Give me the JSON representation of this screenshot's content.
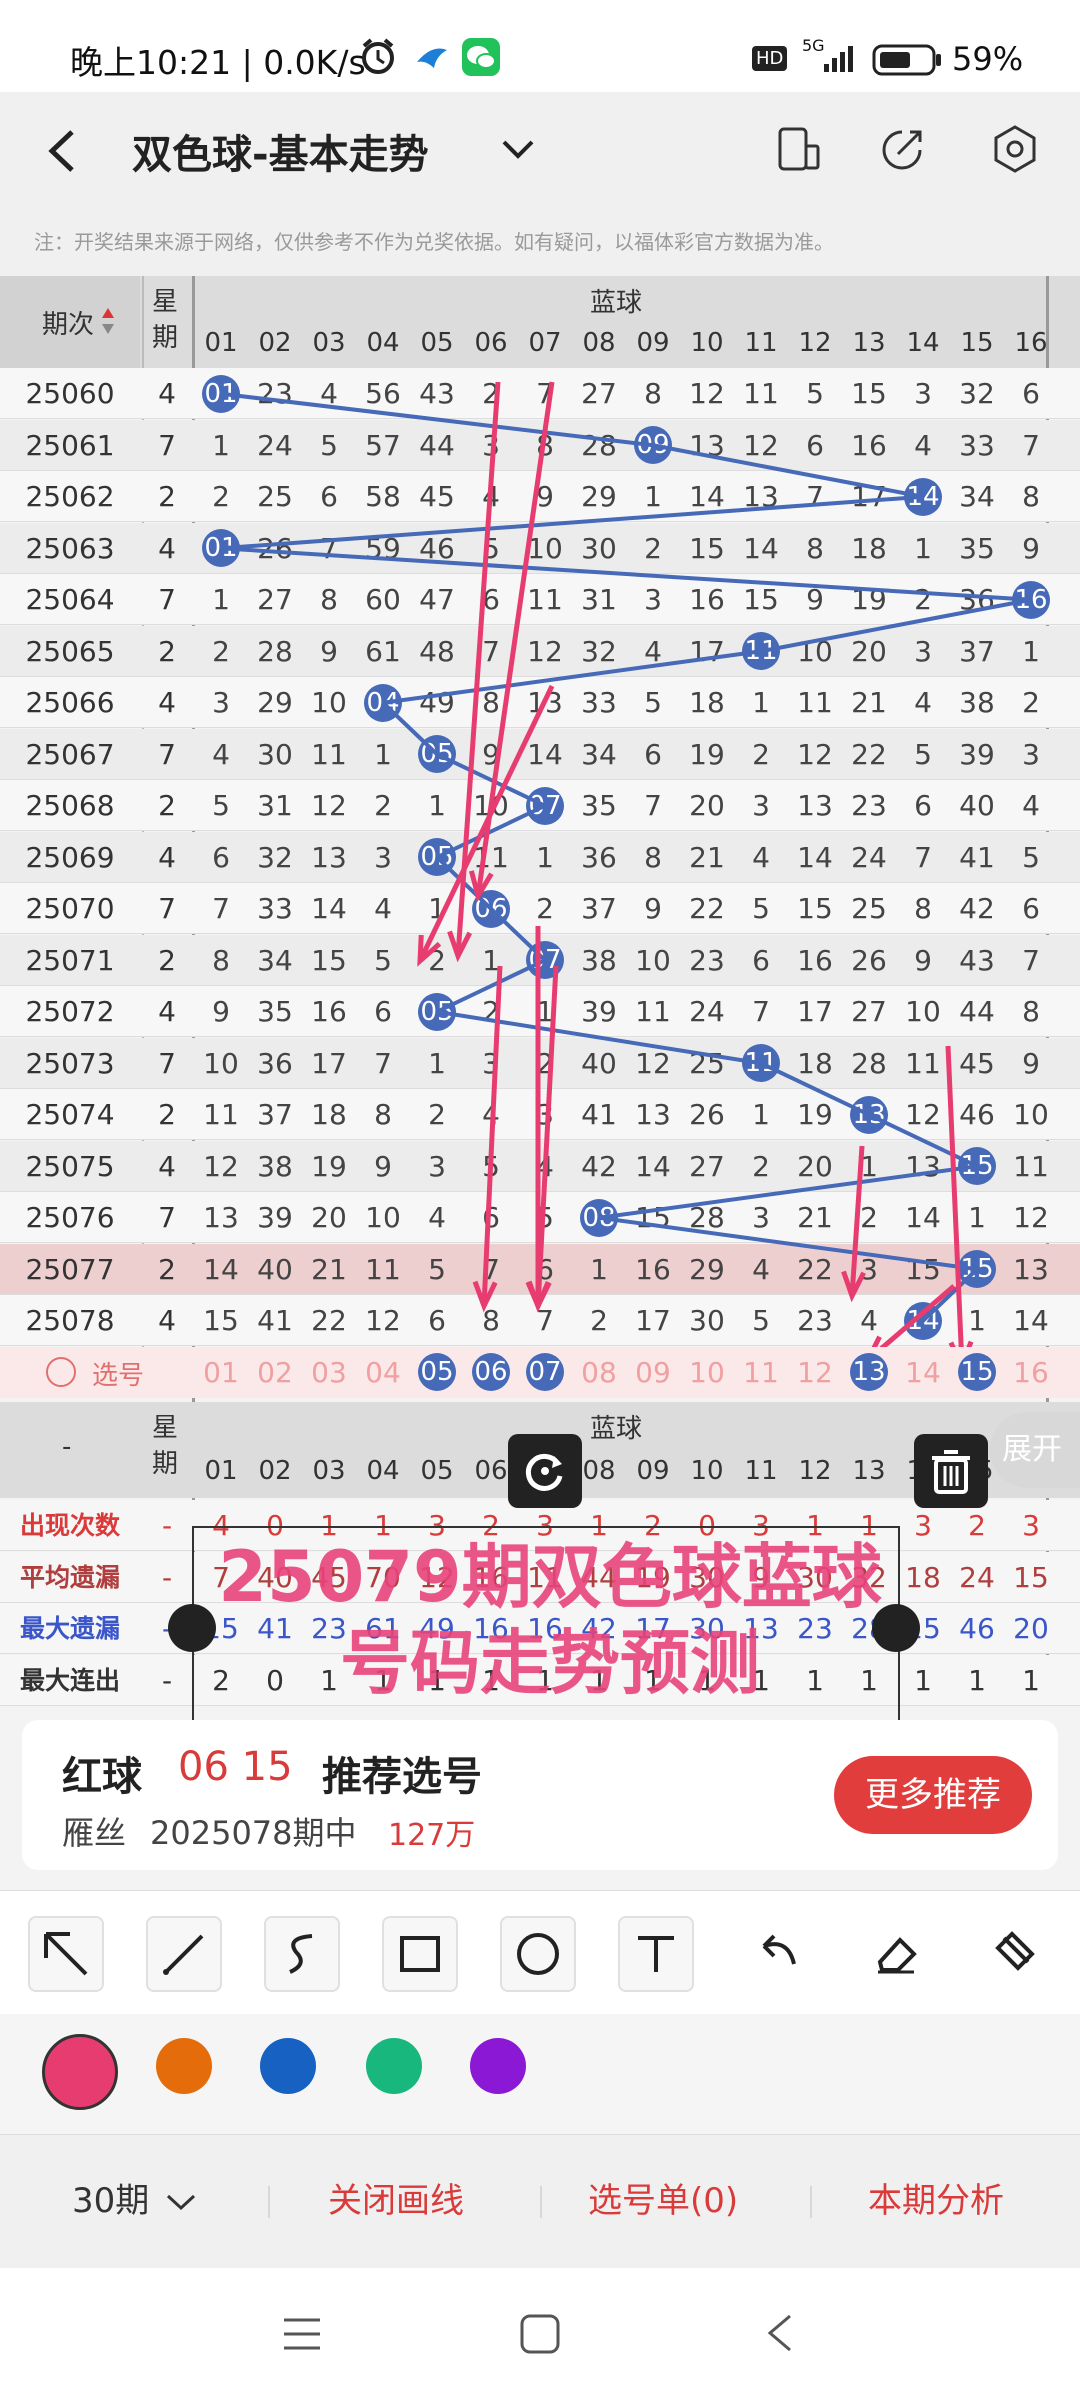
{
  "status": {
    "time": "晚上10:21 | 0.0K/s",
    "network": "5G",
    "battery": "59%",
    "hd": "HD"
  },
  "header": {
    "title": "双色球-基本走势"
  },
  "notice": "注：开奖结果来源于网络，仅供参考不作为兑奖依据。如有疑问，以福体彩官方数据为准。",
  "table": {
    "col_period": "期次",
    "col_week": "星期",
    "section": "蓝球",
    "numbers": [
      "01",
      "02",
      "03",
      "04",
      "05",
      "06",
      "07",
      "08",
      "09",
      "10",
      "11",
      "12",
      "13",
      "14",
      "15",
      "16"
    ],
    "rows": [
      {
        "p": "25060",
        "w": "4",
        "v": [
          "01",
          "23",
          "4",
          "56",
          "43",
          "2",
          "7",
          "27",
          "8",
          "12",
          "11",
          "5",
          "15",
          "3",
          "32",
          "6"
        ],
        "hit": 0
      },
      {
        "p": "25061",
        "w": "7",
        "v": [
          "1",
          "24",
          "5",
          "57",
          "44",
          "3",
          "8",
          "28",
          "09",
          "13",
          "12",
          "6",
          "16",
          "4",
          "33",
          "7"
        ],
        "hit": 8
      },
      {
        "p": "25062",
        "w": "2",
        "v": [
          "2",
          "25",
          "6",
          "58",
          "45",
          "4",
          "9",
          "29",
          "1",
          "14",
          "13",
          "7",
          "17",
          "14",
          "34",
          "8"
        ],
        "hit": 13
      },
      {
        "p": "25063",
        "w": "4",
        "v": [
          "01",
          "26",
          "7",
          "59",
          "46",
          "5",
          "10",
          "30",
          "2",
          "15",
          "14",
          "8",
          "18",
          "1",
          "35",
          "9"
        ],
        "hit": 0
      },
      {
        "p": "25064",
        "w": "7",
        "v": [
          "1",
          "27",
          "8",
          "60",
          "47",
          "6",
          "11",
          "31",
          "3",
          "16",
          "15",
          "9",
          "19",
          "2",
          "36",
          "16"
        ],
        "hit": 15
      },
      {
        "p": "25065",
        "w": "2",
        "v": [
          "2",
          "28",
          "9",
          "61",
          "48",
          "7",
          "12",
          "32",
          "4",
          "17",
          "11",
          "10",
          "20",
          "3",
          "37",
          "1"
        ],
        "hit": 10
      },
      {
        "p": "25066",
        "w": "4",
        "v": [
          "3",
          "29",
          "10",
          "04",
          "49",
          "8",
          "13",
          "33",
          "5",
          "18",
          "1",
          "11",
          "21",
          "4",
          "38",
          "2"
        ],
        "hit": 3
      },
      {
        "p": "25067",
        "w": "7",
        "v": [
          "4",
          "30",
          "11",
          "1",
          "05",
          "9",
          "14",
          "34",
          "6",
          "19",
          "2",
          "12",
          "22",
          "5",
          "39",
          "3"
        ],
        "hit": 4
      },
      {
        "p": "25068",
        "w": "2",
        "v": [
          "5",
          "31",
          "12",
          "2",
          "1",
          "10",
          "07",
          "35",
          "7",
          "20",
          "3",
          "13",
          "23",
          "6",
          "40",
          "4"
        ],
        "hit": 6
      },
      {
        "p": "25069",
        "w": "4",
        "v": [
          "6",
          "32",
          "13",
          "3",
          "05",
          "11",
          "1",
          "36",
          "8",
          "21",
          "4",
          "14",
          "24",
          "7",
          "41",
          "5"
        ],
        "hit": 4
      },
      {
        "p": "25070",
        "w": "7",
        "v": [
          "7",
          "33",
          "14",
          "4",
          "1",
          "06",
          "2",
          "37",
          "9",
          "22",
          "5",
          "15",
          "25",
          "8",
          "42",
          "6"
        ],
        "hit": 5
      },
      {
        "p": "25071",
        "w": "2",
        "v": [
          "8",
          "34",
          "15",
          "5",
          "2",
          "1",
          "07",
          "38",
          "10",
          "23",
          "6",
          "16",
          "26",
          "9",
          "43",
          "7"
        ],
        "hit": 6
      },
      {
        "p": "25072",
        "w": "4",
        "v": [
          "9",
          "35",
          "16",
          "6",
          "05",
          "2",
          "1",
          "39",
          "11",
          "24",
          "7",
          "17",
          "27",
          "10",
          "44",
          "8"
        ],
        "hit": 4
      },
      {
        "p": "25073",
        "w": "7",
        "v": [
          "10",
          "36",
          "17",
          "7",
          "1",
          "3",
          "2",
          "40",
          "12",
          "25",
          "11",
          "18",
          "28",
          "11",
          "45",
          "9"
        ],
        "hit": 10
      },
      {
        "p": "25074",
        "w": "2",
        "v": [
          "11",
          "37",
          "18",
          "8",
          "2",
          "4",
          "3",
          "41",
          "13",
          "26",
          "1",
          "19",
          "13",
          "12",
          "46",
          "10"
        ],
        "hit": 12
      },
      {
        "p": "25075",
        "w": "4",
        "v": [
          "12",
          "38",
          "19",
          "9",
          "3",
          "5",
          "4",
          "42",
          "14",
          "27",
          "2",
          "20",
          "1",
          "13",
          "15",
          "11"
        ],
        "hit": 14
      },
      {
        "p": "25076",
        "w": "7",
        "v": [
          "13",
          "39",
          "20",
          "10",
          "4",
          "6",
          "5",
          "08",
          "15",
          "28",
          "3",
          "21",
          "2",
          "14",
          "1",
          "12"
        ],
        "hit": 7
      },
      {
        "p": "25077",
        "w": "2",
        "v": [
          "14",
          "40",
          "21",
          "11",
          "5",
          "7",
          "6",
          "1",
          "16",
          "29",
          "4",
          "22",
          "3",
          "15",
          "15",
          "13"
        ],
        "hit": 14
      },
      {
        "p": "25078",
        "w": "4",
        "v": [
          "15",
          "41",
          "22",
          "12",
          "6",
          "8",
          "7",
          "2",
          "17",
          "30",
          "5",
          "23",
          "4",
          "14",
          "1",
          "14"
        ],
        "hit": 13
      }
    ],
    "select_label": "选号",
    "selected": [
      4,
      5,
      6,
      12,
      14
    ],
    "stats_section": "蓝球",
    "stats_dash": "-",
    "stats": [
      {
        "label": "出现次数",
        "dash": "-",
        "v": [
          "4",
          "0",
          "1",
          "1",
          "3",
          "2",
          "3",
          "1",
          "2",
          "0",
          "3",
          "1",
          "1",
          "3",
          "2",
          "3"
        ]
      },
      {
        "label": "平均遗漏",
        "dash": "-",
        "v": [
          "7",
          "40",
          "45",
          "70",
          "12",
          "16",
          "11",
          "44",
          "19",
          "30",
          "9",
          "30",
          "32",
          "18",
          "24",
          "15"
        ]
      },
      {
        "label": "最大遗漏",
        "dash": "-",
        "v": [
          "15",
          "41",
          "23",
          "61",
          "49",
          "16",
          "16",
          "42",
          "17",
          "30",
          "13",
          "23",
          "28",
          "15",
          "46",
          "20"
        ]
      },
      {
        "label": "最大连出",
        "dash": "-",
        "v": [
          "2",
          "0",
          "1",
          "1",
          "1",
          "1",
          "1",
          "1",
          "1",
          "1",
          "1",
          "1",
          "1",
          "1",
          "1",
          "1"
        ]
      }
    ]
  },
  "annotation": {
    "line1": "25079期双色球蓝球",
    "line2": "号码走势预测"
  },
  "expand_label": "展开",
  "recommend": {
    "red_label": "红球",
    "red_nums": "06 15",
    "tag": "推荐选号",
    "author": "雁丝",
    "issue": "2025078期中",
    "prize": "127万",
    "more": "更多推荐"
  },
  "colors": {
    "pink": "#e73c70",
    "orange": "#e46c0a",
    "blue": "#1761c2",
    "green": "#18b77e",
    "purple": "#8a18d4",
    "ball": "#4669b8"
  },
  "bottom": {
    "period": "30期",
    "close": "关闭画线",
    "list": "选号单(0)",
    "analysis": "本期分析"
  }
}
